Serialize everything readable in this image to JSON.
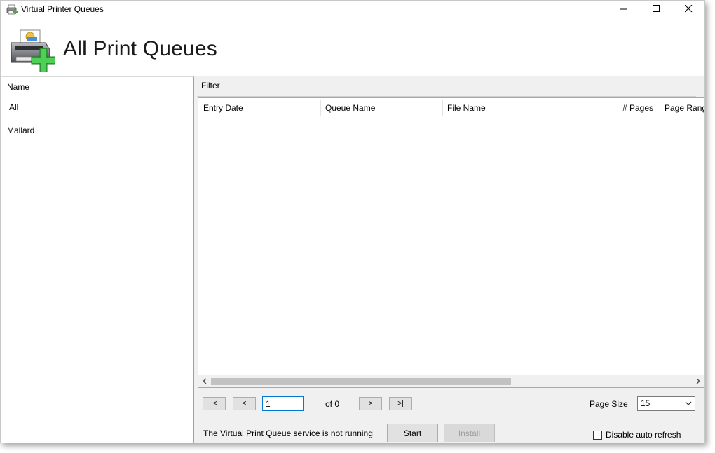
{
  "window": {
    "title": "Virtual Printer Queues",
    "icon": "printer-icon",
    "controls": [
      "minimize-icon",
      "maximize-icon",
      "close-icon"
    ]
  },
  "header": {
    "title": "All Print Queues",
    "icon": "printer-add-icon"
  },
  "left_panel": {
    "column_header": "Name",
    "items": [
      {
        "label": "All"
      },
      {
        "label": "Mallard"
      }
    ]
  },
  "right_panel": {
    "filter_label": "Filter",
    "grid": {
      "columns": [
        "Entry Date",
        "Queue Name",
        "File Name",
        "# Pages",
        "Page Rang"
      ],
      "rows": []
    },
    "pager": {
      "first_label": "|<",
      "prev_label": "<",
      "current_page": "1",
      "of_text": "of 0",
      "next_label": ">",
      "last_label": ">|",
      "page_size_label": "Page Size",
      "page_size_value": "15"
    },
    "status_text": "The Virtual Print Queue service is not running",
    "start_label": "Start",
    "install_label": "Install",
    "disable_refresh_label": "Disable auto refresh",
    "disable_refresh_checked": false
  },
  "colors": {
    "accent_focus": "#0078d7",
    "panel_bg": "#f0f0f0",
    "plus_green": "#3cb043"
  }
}
